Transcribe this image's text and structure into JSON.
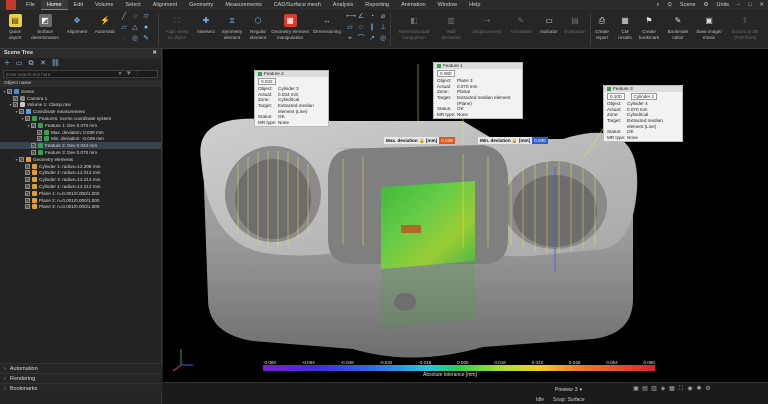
{
  "menubar": {
    "items": [
      "File",
      "Home",
      "Edit",
      "Volume",
      "Select",
      "Alignment",
      "Geometry",
      "Measurements",
      "CAD/Surface mesh",
      "Analysis",
      "Reporting",
      "Animation",
      "Window",
      "Help"
    ],
    "active_index": 1,
    "scene": "Scene",
    "units": "Units"
  },
  "ribbon": {
    "buttons": [
      {
        "label": "Quick\nimport",
        "icon": "quick-import-icon"
      },
      {
        "label": "Surface\ndetermination",
        "icon": "surface-determination-icon"
      },
      {
        "label": "Alignment",
        "icon": "alignment-icon"
      },
      {
        "label": "Automatic",
        "icon": "automatic-icon"
      },
      {
        "label": "Align views\nto object",
        "icon": "align-views-icon"
      },
      {
        "label": "Intersect",
        "icon": "intersect-icon"
      },
      {
        "label": "Symmetry\nelement",
        "icon": "symmetry-element-icon"
      },
      {
        "label": "Regular\nelement",
        "icon": "regular-element-icon"
      },
      {
        "label": "Geometry element\nmanipulation",
        "icon": "geometry-manipulation-icon"
      },
      {
        "label": "Dimensioning",
        "icon": "dimensioning-icon"
      },
      {
        "label": "Nominal/actual\ncomparison",
        "icon": "nominal-actual-icon"
      },
      {
        "label": "Wall\nthickness",
        "icon": "wall-thickness-icon"
      },
      {
        "label": "Displacement",
        "icon": "displacement-icon"
      },
      {
        "label": "Annotation",
        "icon": "annotation-icon"
      },
      {
        "label": "Indicator",
        "icon": "indicator-icon"
      },
      {
        "label": "Evaluation",
        "icon": "evaluation-icon"
      },
      {
        "label": "Create\nreport",
        "icon": "create-report-icon"
      },
      {
        "label": "CM\nresults",
        "icon": "cm-results-icon"
      },
      {
        "label": "Create\nbookmark",
        "icon": "create-bookmark-icon"
      },
      {
        "label": "Bookmark\neditor",
        "icon": "bookmark-editor-icon"
      },
      {
        "label": "Save image/\nmovie",
        "icon": "save-image-icon"
      },
      {
        "label": "Export as 3D\n(PDF/html)",
        "icon": "export-3d-icon"
      }
    ]
  },
  "scene_tree": {
    "title": "Scene Tree",
    "search_placeholder": "Enter search text here",
    "column_header": "Object name",
    "rows": [
      {
        "label": "Scene",
        "level": 0,
        "icon_color": "#4a90d0"
      },
      {
        "label": "Camera 1",
        "level": 1,
        "icon_color": "#888888"
      },
      {
        "label": "Volume 1: Clamp.raw",
        "level": 1,
        "icon_color": "#c8c8c8"
      },
      {
        "label": "Coordinate measurement",
        "level": 2,
        "icon_color": "#5aa0e0"
      },
      {
        "label": "Features: Scene coordinate system",
        "level": 3,
        "icon_color": "#3aa04a"
      },
      {
        "label": "Feature 1: Dev 0.070 mm",
        "level": 4,
        "icon_color": "#3aa04a"
      },
      {
        "label": "Max. deviation: 0.039 mm",
        "level": 5,
        "icon_color": "#3aa04a"
      },
      {
        "label": "Min. deviation: -0.039 mm",
        "level": 5,
        "icon_color": "#3aa04a"
      },
      {
        "label": "Feature 2: Dev 0.034 mm",
        "level": 4,
        "icon_color": "#3aa04a"
      },
      {
        "label": "Feature 3: Dev 0.070 mm",
        "level": 4,
        "icon_color": "#3aa04a"
      },
      {
        "label": "Geometry elements",
        "level": 2,
        "icon_color": "#e0a030"
      },
      {
        "label": "Cylinder 1: radius=12.208 mm",
        "level": 3,
        "icon_color": "#e0a030"
      },
      {
        "label": "Cylinder 2: radius=12.213 mm",
        "level": 3,
        "icon_color": "#e0a030"
      },
      {
        "label": "Cylinder 3: radius=12.213 mm",
        "level": 3,
        "icon_color": "#e0a030"
      },
      {
        "label": "Cylinder 4: radius=12.213 mm",
        "level": 3,
        "icon_color": "#e0a030"
      },
      {
        "label": "Plane 1: n=0.001/0.000/1.000",
        "level": 3,
        "icon_color": "#e0a030"
      },
      {
        "label": "Plane 2: n=0.001/0.000/1.000",
        "level": 3,
        "icon_color": "#e0a030"
      },
      {
        "label": "Plane 3: n=0.001/0.000/1.000",
        "level": 3,
        "icon_color": "#e0a030"
      }
    ],
    "bottom_sections": [
      "Automation",
      "Rendering",
      "Bookmarks"
    ]
  },
  "callouts": {
    "feature2": {
      "title": "Feature 2",
      "value": "0.032",
      "object": "Cylinder 3",
      "actual": "0.034 mm",
      "zone": "Cylindrical",
      "target": "Extracted median element (Line)",
      "status": "OK",
      "mr_type": "None"
    },
    "feature1": {
      "title": "Feature 1",
      "value": "0.080",
      "object": "Plane 3",
      "actual": "0.070 mm",
      "zone": "Planar",
      "target": "Extracted median element (Plane)",
      "status": "OK",
      "mr_type": "None"
    },
    "feature3": {
      "title": "Feature 3",
      "value": "0.100",
      "value2": "Cylinder 1",
      "object": "Cylinder 4",
      "actual": "0.070 mm",
      "zone": "Cylindrical",
      "target": "Extracted median element (Line)",
      "status": "OK",
      "mr_type": "None"
    },
    "labels": {
      "object": "Object:",
      "actual": "Actual:",
      "zone": "Zone:",
      "target": "Target:",
      "status": "Status:",
      "mr_type": "MR type:"
    }
  },
  "deviation_boxes": {
    "max": {
      "label": "Max. deviation",
      "unit": "[mm]",
      "value": "0.039",
      "color": "#e0571e"
    },
    "min": {
      "label": "Min. deviation",
      "unit": "[mm]",
      "value": "0.030",
      "color": "#2a60d0"
    }
  },
  "color_scale": {
    "ticks": [
      "-0.080",
      "-0.064",
      "-0.048",
      "-0.032",
      "-0.016",
      "0.000",
      "0.016",
      "0.032",
      "0.048",
      "0.064",
      "0.080"
    ],
    "title": "Absolute tolerance [mm]"
  },
  "statusbar": {
    "preview": "Preview",
    "preview_value": "3",
    "idle": "Idle",
    "snap": "Snap: Surface"
  }
}
